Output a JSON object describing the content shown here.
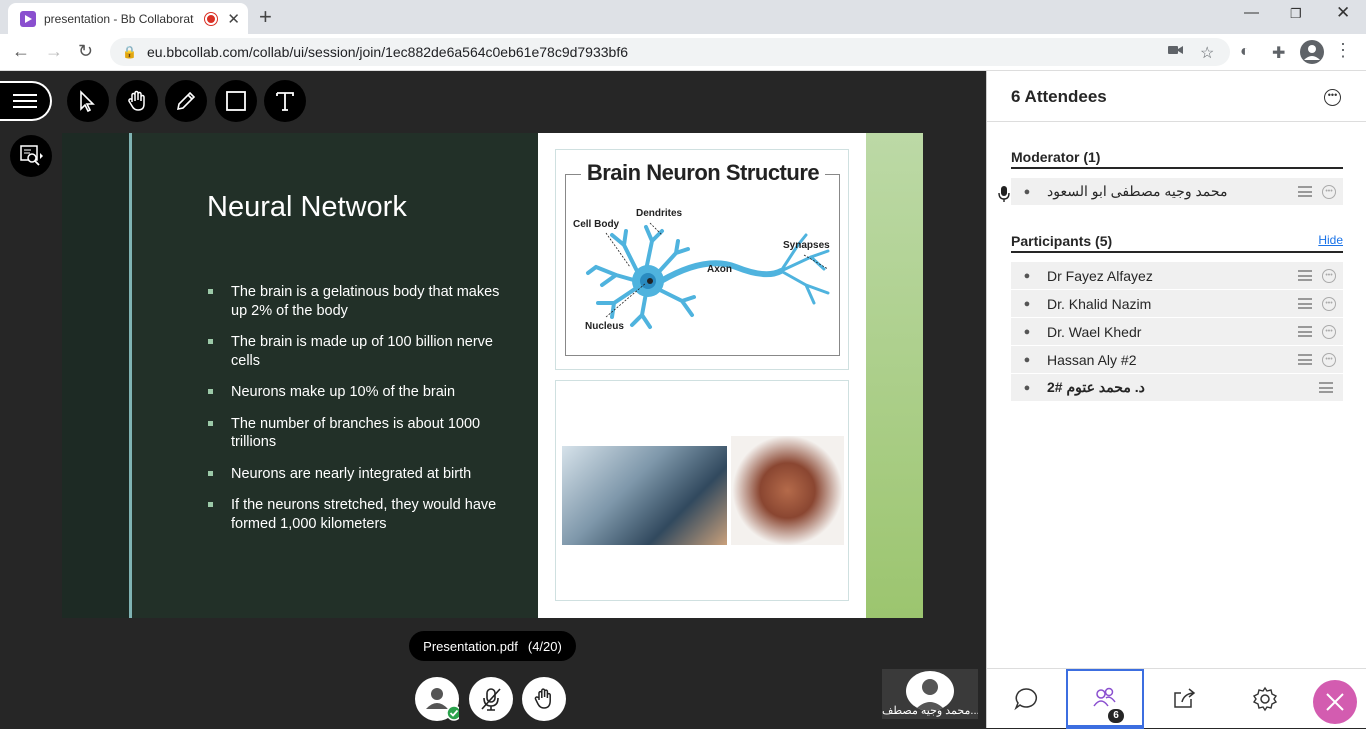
{
  "browser": {
    "tab_title": "presentation - Bb Collaborat",
    "url": "eu.bbcollab.com/collab/ui/session/join/1ec882de6a564c0eb61e78c9d7933bf6"
  },
  "slide": {
    "title": "Neural Network",
    "bullets": [
      "The brain is a gelatinous body that makes up 2% of the body",
      "The brain is made up of 100 billion nerve cells",
      "Neurons make up 10% of the brain",
      "The number of branches is about 1000 trillions",
      "Neurons are nearly integrated at birth",
      "If the neurons stretched, they would have formed 1,000 kilometers"
    ],
    "diagram_title": "Brain Neuron Structure",
    "labels": {
      "cell_body": "Cell Body",
      "dendrites": "Dendrites",
      "synapses": "Synapses",
      "axon": "Axon",
      "nucleus": "Nucleus"
    }
  },
  "pagination": {
    "file": "Presentation.pdf",
    "page": "(4/20)"
  },
  "self_view": {
    "name": "محمد وجيه مصطف..."
  },
  "attendees": {
    "title": "6 Attendees",
    "moderator_header": "Moderator (1)",
    "moderator": "محمد وجيه مصطفى ابو السعود",
    "participants_header": "Participants (5)",
    "hide_label": "Hide",
    "participants": [
      "Dr Fayez Alfayez",
      "Dr. Khalid Nazim",
      "Dr. Wael Khedr",
      "Hassan Aly #2",
      "د. محمد عتوم #2"
    ],
    "badge_count": "6"
  },
  "colors": {
    "accent": "#3c6ee0",
    "close": "#d35cb0",
    "link": "#1a73e8"
  }
}
